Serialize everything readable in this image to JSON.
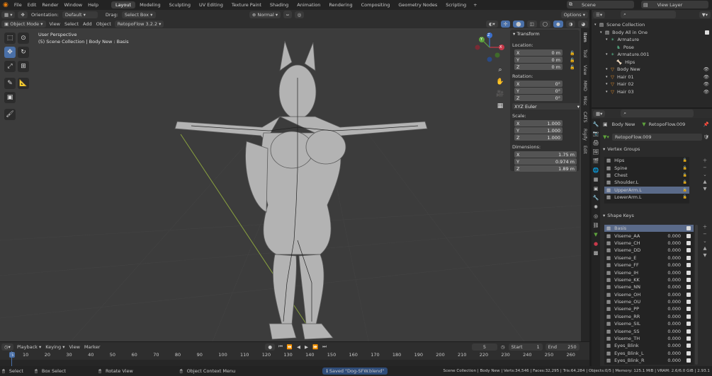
{
  "menu": {
    "items": [
      "File",
      "Edit",
      "Render",
      "Window",
      "Help"
    ],
    "workspaces": [
      "Layout",
      "Modeling",
      "Sculpting",
      "UV Editing",
      "Texture Paint",
      "Shading",
      "Animation",
      "Rendering",
      "Compositing",
      "Geometry Nodes",
      "Scripting"
    ],
    "active_workspace": "Layout",
    "add_tab": "+",
    "scene": "Scene",
    "view_layer": "View Layer"
  },
  "tool_header": {
    "orientation_label": "Orientation:",
    "orientation_value": "Default",
    "drag_label": "Drag:",
    "drag_value": "Select Box",
    "pivot": "Normal",
    "options": "Options"
  },
  "viewport_header": {
    "mode": "Object Mode",
    "menus": [
      "View",
      "Select",
      "Add",
      "Object"
    ],
    "addon": "RetopoFlow 3.2.2"
  },
  "viewport": {
    "perspective": "User Perspective",
    "collection_info": "(5) Scene Collection | Body New : Basis",
    "gizmo_axes": [
      "X",
      "Y",
      "Z"
    ]
  },
  "npanel": {
    "title": "Transform",
    "location_label": "Location:",
    "location": [
      {
        "axis": "X",
        "value": "0 m"
      },
      {
        "axis": "Y",
        "value": "0 m"
      },
      {
        "axis": "Z",
        "value": "0 m"
      }
    ],
    "rotation_label": "Rotation:",
    "rotation": [
      {
        "axis": "X",
        "value": "0°"
      },
      {
        "axis": "Y",
        "value": "0°"
      },
      {
        "axis": "Z",
        "value": "0°"
      }
    ],
    "rotation_mode": "XYZ Euler",
    "scale_label": "Scale:",
    "scale": [
      {
        "axis": "X",
        "value": "1.000"
      },
      {
        "axis": "Y",
        "value": "1.000"
      },
      {
        "axis": "Z",
        "value": "1.000"
      }
    ],
    "dimensions_label": "Dimensions:",
    "dimensions": [
      {
        "axis": "X",
        "value": "1.75 m"
      },
      {
        "axis": "Y",
        "value": "0.974 m"
      },
      {
        "axis": "Z",
        "value": "1.89 m"
      }
    ],
    "tabs": [
      "Item",
      "Tool",
      "View",
      "MMD",
      "Misc",
      "CATS",
      "Rigify",
      "Edit"
    ]
  },
  "outliner": {
    "rows": [
      {
        "label": "Scene Collection",
        "indent": 0,
        "icon": "collection-icon"
      },
      {
        "label": "Body All in One",
        "indent": 1,
        "icon": "collection-icon"
      },
      {
        "label": "Armature",
        "indent": 2,
        "icon": "armature-icon"
      },
      {
        "label": "Pose",
        "indent": 3,
        "icon": "pose-icon"
      },
      {
        "label": "Armature.001",
        "indent": 2,
        "icon": "armature-icon"
      },
      {
        "label": "Hips",
        "indent": 3,
        "icon": "bone-icon"
      },
      {
        "label": "Body New",
        "indent": 2,
        "icon": "mesh-icon"
      },
      {
        "label": "Hair 01",
        "indent": 2,
        "icon": "mesh-icon"
      },
      {
        "label": "Hair 02",
        "indent": 2,
        "icon": "mesh-icon"
      },
      {
        "label": "Hair 03",
        "indent": 2,
        "icon": "mesh-icon"
      }
    ]
  },
  "properties": {
    "object_name": "Body New",
    "data_name": "RetopoFlow.009",
    "mesh_name": "RetopoFlow.009",
    "vertex_groups_title": "Vertex Groups",
    "vertex_groups": [
      "Hips",
      "Spine",
      "Chest",
      "Shoulder.L",
      "UpperArm.L",
      "LowerArm.L"
    ],
    "selected_vertex_group": "UpperArm.L",
    "shape_keys_title": "Shape Keys",
    "shape_keys": [
      {
        "name": "Basis",
        "value": ""
      },
      {
        "name": "Viseme_AA",
        "value": "0.000"
      },
      {
        "name": "Viseme_CH",
        "value": "0.000"
      },
      {
        "name": "Viseme_DD",
        "value": "0.000"
      },
      {
        "name": "Viseme_E",
        "value": "0.000"
      },
      {
        "name": "Viseme_FF",
        "value": "0.000"
      },
      {
        "name": "Viseme_IH",
        "value": "0.000"
      },
      {
        "name": "Viseme_KK",
        "value": "0.000"
      },
      {
        "name": "Viseme_NN",
        "value": "0.000"
      },
      {
        "name": "Viseme_OH",
        "value": "0.000"
      },
      {
        "name": "Viseme_OU",
        "value": "0.000"
      },
      {
        "name": "Viseme_PP",
        "value": "0.000"
      },
      {
        "name": "Viseme_RR",
        "value": "0.000"
      },
      {
        "name": "Viseme_SIL",
        "value": "0.000"
      },
      {
        "name": "Viseme_SS",
        "value": "0.000"
      },
      {
        "name": "Viseme_TH",
        "value": "0.000"
      },
      {
        "name": "Eyes_Blink",
        "value": "0.000"
      },
      {
        "name": "Eyes_Blink_L",
        "value": "0.000"
      },
      {
        "name": "Eyes_Blink_R",
        "value": "0.000"
      }
    ]
  },
  "timeline": {
    "menus": [
      "Playback",
      "Keying",
      "View",
      "Marker"
    ],
    "current_frame": "5",
    "start_label": "Start",
    "start": "1",
    "end_label": "End",
    "end": "250",
    "ruler": [
      "5",
      "10",
      "20",
      "30",
      "40",
      "50",
      "60",
      "70",
      "80",
      "90",
      "100",
      "110",
      "120",
      "130",
      "140",
      "150",
      "160",
      "170",
      "180",
      "190",
      "200",
      "210",
      "220",
      "230",
      "240",
      "250",
      "260"
    ]
  },
  "status": {
    "select": "Select",
    "box_select": "Box Select",
    "rotate_view": "Rotate View",
    "context_menu": "Object Context Menu",
    "saved_message": "Saved \"Dog-SFW.blend\"",
    "stats": "Scene Collection | Body New | Verts:34,546 | Faces:32,295 | Tris:64,284 | Objects:0/5 | Memory: 125.1 MiB | VRAM: 2.6/6.0 GiB | 2.93.1"
  },
  "colors": {
    "accent": "#4a70a8",
    "axis_x": "#c8394a",
    "axis_y": "#5ea33c",
    "axis_z": "#3b6fcc",
    "selected_row": "#5a6a89"
  }
}
